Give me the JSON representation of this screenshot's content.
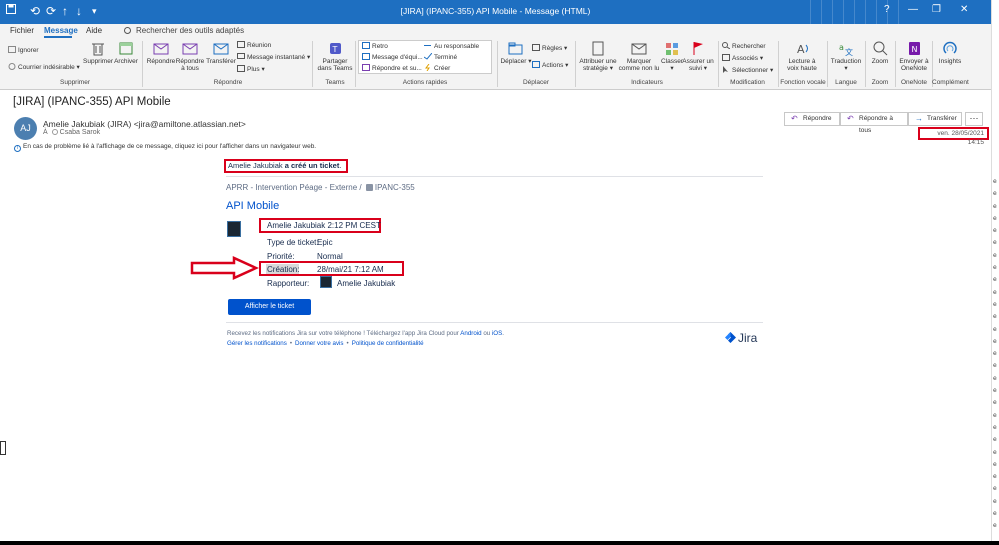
{
  "window": {
    "title": "[JIRA] (IPANC-355) API Mobile  -  Message (HTML)",
    "controls": [
      "?",
      "—",
      "❐",
      "✕"
    ]
  },
  "quick_access": [
    "⟲",
    "⟳",
    "↑",
    "↓",
    "▾"
  ],
  "menu": {
    "tabs": [
      "Fichier",
      "Message",
      "Aide"
    ],
    "active_tab": "Message",
    "search_tools": "Rechercher des outils adaptés"
  },
  "ribbon": {
    "groups": {
      "supprimer": "Supprimer",
      "repondre": "Répondre",
      "teams": "Teams",
      "actions_rapides": "Actions rapides",
      "deplacer": "Déplacer",
      "indicateurs": "Indicateurs",
      "modification": "Modification",
      "fonction_vocale": "Fonction vocale",
      "langue": "Langue",
      "zoom": "Zoom",
      "onenote": "OneNote",
      "complement": "Complément"
    },
    "buttons": {
      "ignorer": "Ignorer",
      "courrier_indesirable": "Courrier indésirable",
      "supprimer": "Supprimer",
      "archiver": "Archiver",
      "repondre": "Répondre",
      "repondre_a_tous_1": "Répondre",
      "repondre_a_tous_2": "à tous",
      "transferer": "Transférer",
      "reunion": "Réunion",
      "message_instantane": "Message instantané",
      "plus": "Plus",
      "partager_1": "Partager",
      "partager_2": "dans Teams",
      "qs_retro": "Retro",
      "qs_message_equipe": "Message d'équi...",
      "qs_repondre_suppr": "Répondre et su...",
      "qs_au_responsable": "Au responsable",
      "qs_termine": "Terminé",
      "qs_creer": "Créer",
      "deplacer": "Déplacer",
      "regles": "Règles",
      "actions": "Actions",
      "attribuer_1": "Attribuer une",
      "attribuer_2": "stratégie",
      "marquer_1": "Marquer",
      "marquer_2": "comme non lu",
      "classer": "Classer",
      "assurer_1": "Assurer un",
      "assurer_2": "suivi",
      "rechercher": "Rechercher",
      "associes": "Associés",
      "selectionner": "Sélectionner",
      "lecture_1": "Lecture à",
      "lecture_2": "voix haute",
      "traduction": "Traduction",
      "zoom": "Zoom",
      "envoyer_1": "Envoyer à",
      "envoyer_2": "OneNote",
      "insights": "Insights"
    }
  },
  "message": {
    "subject": "[JIRA] (IPANC-355) API Mobile",
    "avatar_initials": "AJ",
    "sender": "Amelie Jakubiak (JIRA) <jira@amiltone.atlassian.net>",
    "to_label": "À",
    "to_name": "Csaba Sarok",
    "info_text": "En cas de problème lié à l'affichage de ce message, cliquez ici pour l'afficher dans un navigateur web.",
    "date": "ven. 28/05/2021 14:15",
    "actions": {
      "reply": "Répondre",
      "reply_all": "Répondre à tous",
      "forward": "Transférer",
      "more": "···"
    }
  },
  "email_body": {
    "created_by_name": "Amelie Jakubiak",
    "created_action": "a créé un ticket",
    "created_period": ".",
    "breadcrumb_project": "APRR - Intervention Péage - Externe",
    "breadcrumb_sep": "/",
    "breadcrumb_issue": "IPANC-355",
    "issue_title": "API Mobile",
    "comment_line": "Amelie Jakubiak 2:12 PM CEST",
    "fields": [
      {
        "label": "Type de ticket:",
        "value": "Epic"
      },
      {
        "label": "Priorité:",
        "value": "Normal"
      },
      {
        "label": "Création:",
        "value": "28/mai/21 7:12 AM"
      },
      {
        "label": "Rapporteur:",
        "value": "Amelie Jakubiak"
      }
    ],
    "open_button": "Afficher le ticket",
    "footer_text": "Recevez les notifications Jira sur votre téléphone ! Téléchargez l'app Jira Cloud pour",
    "footer_android": "Android",
    "footer_or": "ou",
    "footer_ios": "iOS",
    "footer_end": ".",
    "footer_links": [
      "Gérer les notifications",
      "Donner votre avis",
      "Politique de confidentialité"
    ],
    "footer_dot": "•",
    "jira_logo": "Jira"
  },
  "colors": {
    "title_bar": "#1e6fc1",
    "highlight_red": "#d9001b",
    "jira_blue": "#0052cc"
  }
}
